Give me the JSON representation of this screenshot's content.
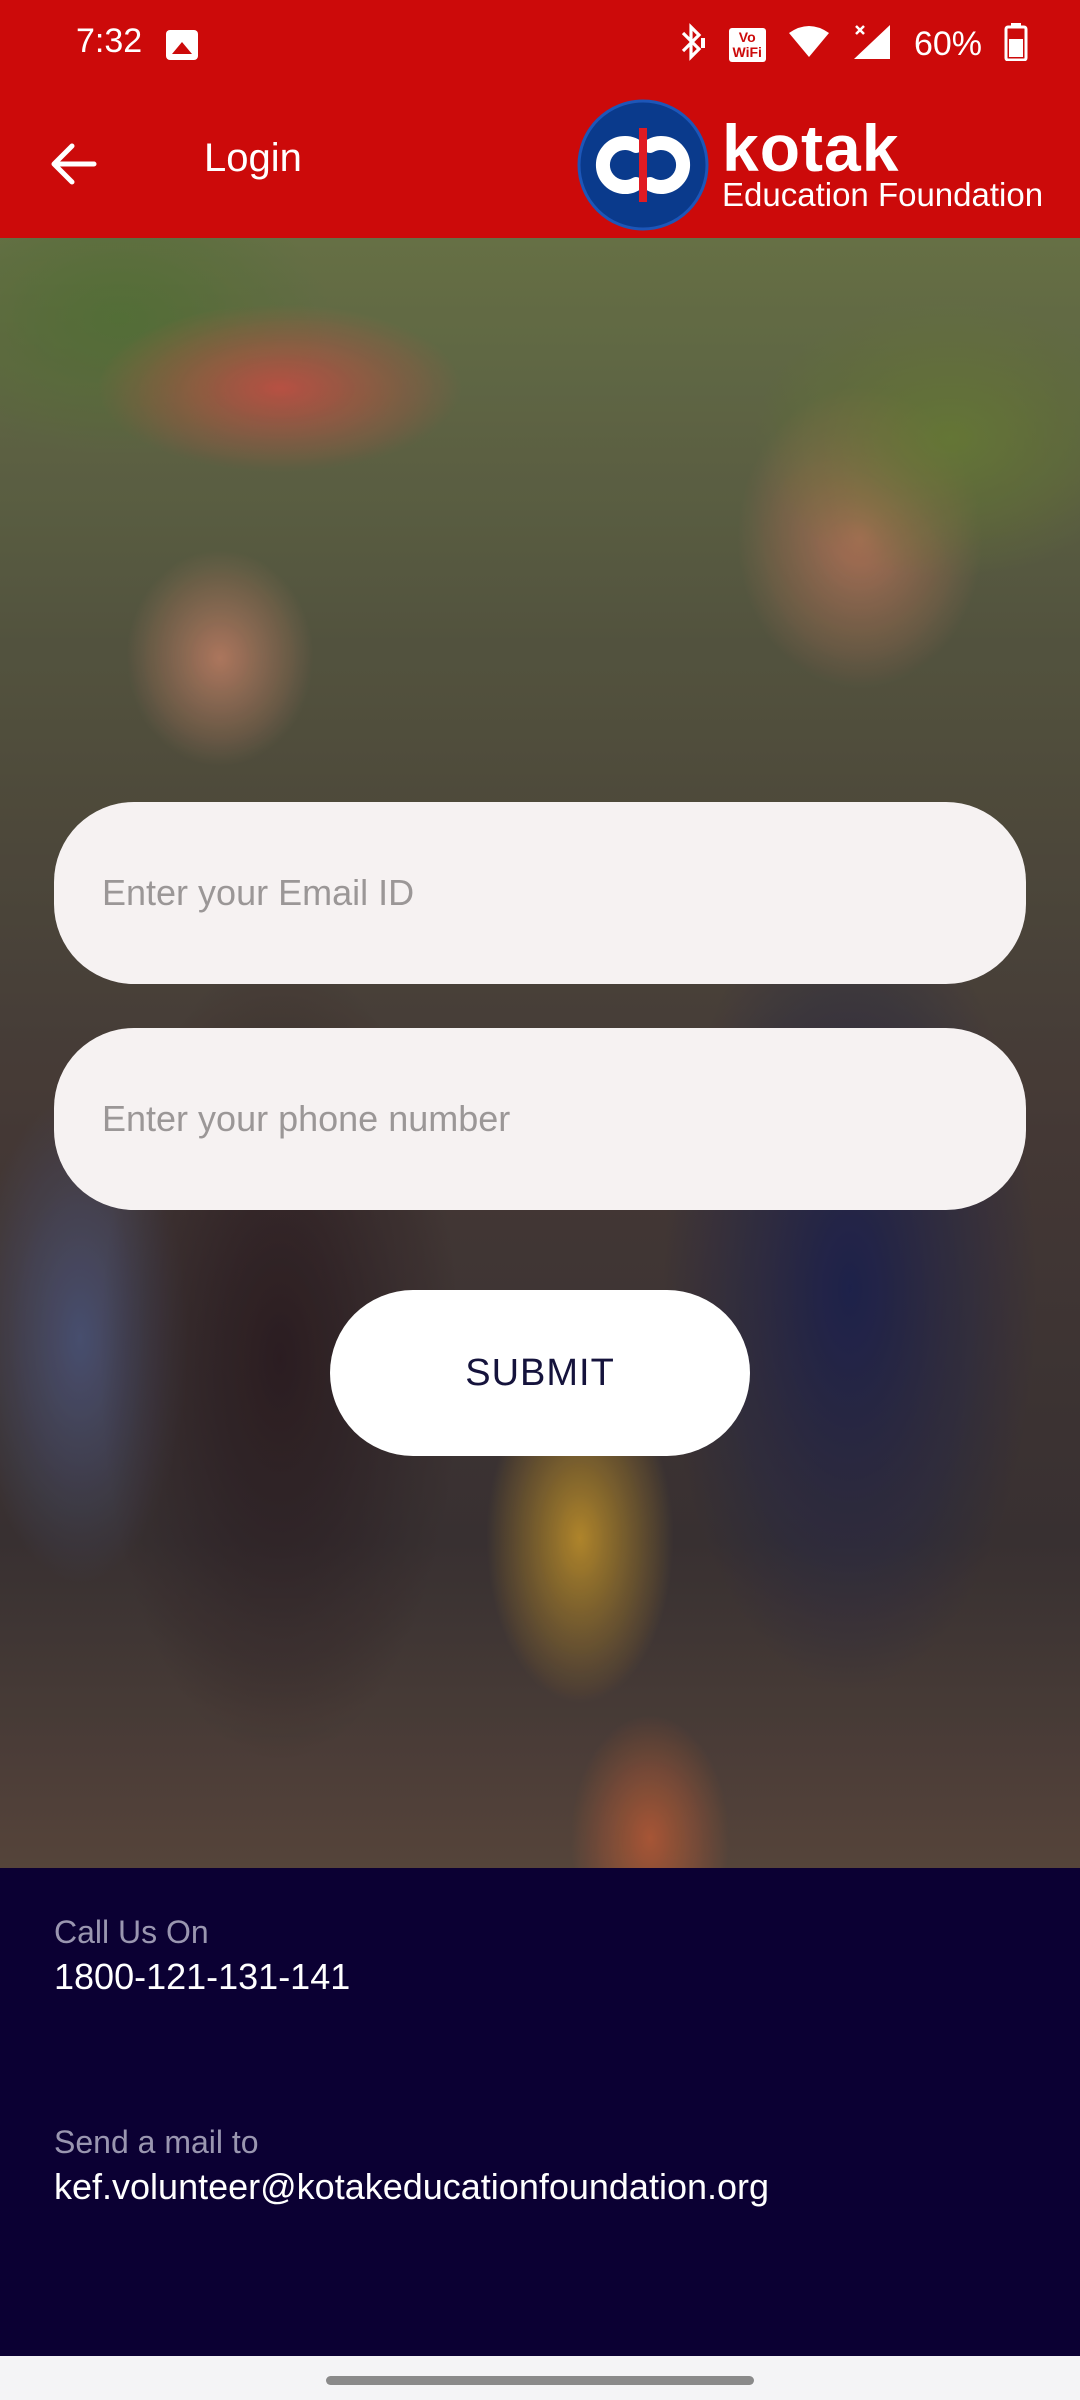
{
  "status_bar": {
    "time": "7:32",
    "battery": "60%",
    "volte_line1": "Vo",
    "volte_line2": "WiFi"
  },
  "app_bar": {
    "title": "Login",
    "brand_name": "kotak",
    "brand_sub": "Education Foundation"
  },
  "form": {
    "email_placeholder": "Enter your Email ID",
    "email_value": "",
    "phone_placeholder": "Enter your phone number",
    "phone_value": "",
    "submit_label": "SUBMIT"
  },
  "footer": {
    "call_label": "Call Us On",
    "phone": "1800-121-131-141",
    "mail_label": "Send a mail to",
    "email": "kef.volunteer@kotakeducationfoundation.org"
  },
  "colors": {
    "brand_red": "#cc0a0a",
    "footer_navy": "#0b0033",
    "field_bg": "#f6f2f2",
    "logo_blue": "#0a3a8c"
  },
  "icons": {
    "back": "arrow-left-icon",
    "image_notification": "image-icon",
    "bluetooth": "bluetooth-icon",
    "wifi": "wifi-icon",
    "signal": "signal-icon",
    "battery": "battery-icon"
  }
}
